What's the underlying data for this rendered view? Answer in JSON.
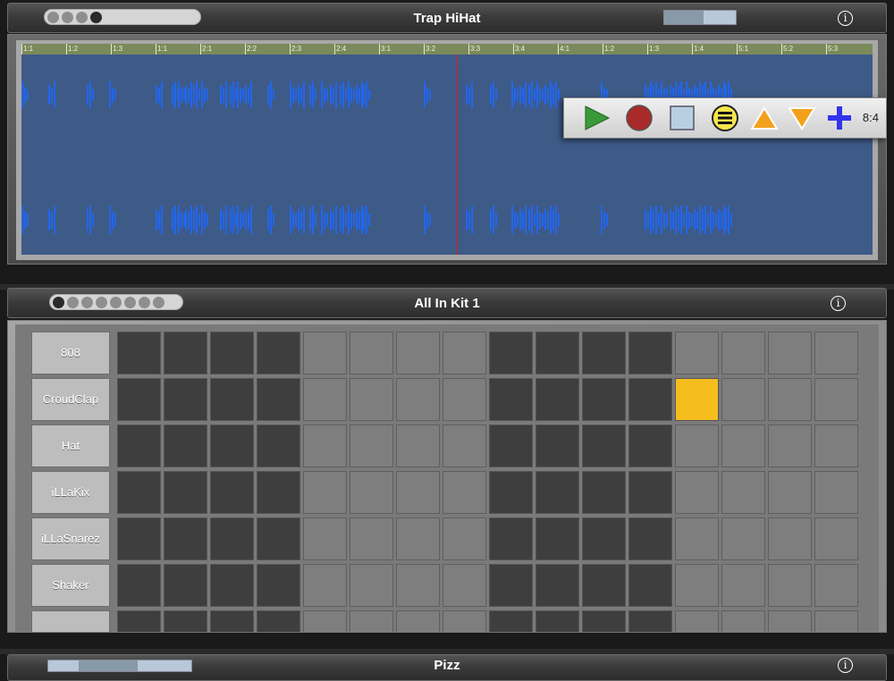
{
  "panel1": {
    "title": "Trap HiHat",
    "dots_total": 4,
    "dots_active": 4,
    "slider_value": 0.55,
    "info_label": "i",
    "timeline_ticks": [
      "1:1",
      "1:2",
      "1:3",
      "1:1",
      "2:1",
      "2:2",
      "2:3",
      "2:4",
      "3:1",
      "3:2",
      "3:3",
      "3:4",
      "4:1",
      "1:2",
      "1:3",
      "1:4",
      "5:1",
      "5:2",
      "5:3"
    ],
    "wave_color": "#2266ee",
    "playhead_color": "#d02020"
  },
  "transport": {
    "play_icon": "play-icon",
    "record_icon": "record-icon",
    "stop_icon": "stop-icon",
    "menu_icon": "menu-icon",
    "up_icon": "arrow-up-icon",
    "down_icon": "arrow-down-icon",
    "add_icon": "plus-icon",
    "position": "8:4"
  },
  "panel2": {
    "title": "All In Kit 1",
    "dots_total": 8,
    "dots_active": 1,
    "info_label": "i",
    "tracks": [
      "808",
      "CroudClap",
      "Hat",
      "iLLaKix",
      "iLLaSnarez",
      "Shaker",
      ""
    ],
    "steps": 16,
    "active_pad": {
      "row": 1,
      "step": 12
    },
    "active_color": "#f5be1e"
  },
  "panel3": {
    "title": "Pizz",
    "info_label": "i"
  }
}
